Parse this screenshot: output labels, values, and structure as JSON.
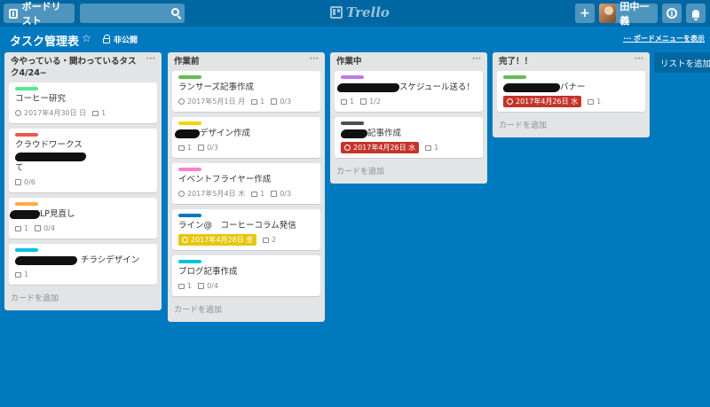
{
  "header": {
    "boards_label": "ボードリスト",
    "search_placeholder": "",
    "logo_text": "Trello",
    "add_symbol": "+",
    "user_name": "田中一義",
    "info_symbol": "i"
  },
  "board": {
    "title": "タスク管理表",
    "star": "☆",
    "visibility": "非公開",
    "menu_label": "ボードメニューを表示",
    "list_menu": "···",
    "add_list": "リストを追加"
  },
  "colors": {
    "green": "#61bd4f",
    "red": "#eb5a46",
    "orange": "#ffab4a",
    "sky": "#00c2e0",
    "yellow": "#f2d600",
    "pink": "#ff80ce",
    "blue": "#0079bf",
    "purple": "#c377e0",
    "black": "#4d4d4d"
  },
  "lists": [
    {
      "title": "今やっている・関わっているタスク4/24~",
      "add_card": "カードを追加",
      "cards": [
        {
          "text": "コーヒー研究",
          "date": "2017年4月30日 日",
          "comments": "1"
        },
        {
          "text_pre": "クラウドワークス",
          "text_post": "て",
          "checklist": "0/6"
        },
        {
          "text": "LP見直し",
          "comments": "1",
          "checklist": "0/4"
        },
        {
          "text": "チラシデザイン",
          "comments": "1"
        }
      ]
    },
    {
      "title": "作業前",
      "add_card": "カードを追加",
      "cards": [
        {
          "text": "ランサーズ記事作成",
          "date": "2017年5月1日 月",
          "comments": "1",
          "checklist": "0/3"
        },
        {
          "text": "デザイン作成",
          "comments": "1",
          "checklist": "0/3"
        },
        {
          "text": "イベントフライヤー作成",
          "date": "2017年5月4日 木",
          "comments": "1",
          "checklist": "0/3"
        },
        {
          "text": "ライン@　コーヒーコラム発信",
          "date": "2017年4月28日 金",
          "comments": "2"
        },
        {
          "text": "ブログ記事作成",
          "comments": "1",
          "checklist": "0/4"
        }
      ]
    },
    {
      "title": "作業中",
      "add_card": "カードを追加",
      "cards": [
        {
          "text": "スケジュール送る！",
          "comments": "1",
          "checklist": "1/2"
        },
        {
          "text": "記事作成",
          "date": "2017年4月26日 水",
          "comments": "1"
        }
      ]
    },
    {
      "title": "完了！！",
      "add_card": "カードを追加",
      "cards": [
        {
          "text": "バナー",
          "date": "2017年4月26日 水",
          "comments": "1"
        }
      ]
    }
  ]
}
